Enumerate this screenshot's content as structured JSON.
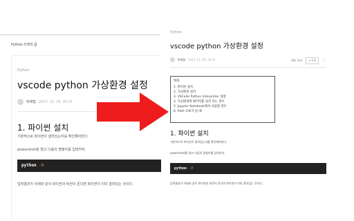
{
  "left": {
    "breadcrumb": "Python 5개의 글",
    "category": "Python",
    "title": "vscode python 가상환경 설정",
    "author": "박재형",
    "date": "2023. 11. 24. 20:31",
    "heading": "1. 파이썬 설치",
    "para1": "기본적으로 파이썬이 깔려있는지를 확인해야한다.",
    "para2": "powershell을 열고 다음의 명령어를 입력하자.",
    "code_cmd": "python",
    "code_flag": "-V",
    "para3": "입력결과가 아래와 같이 파이썬과 버전이 존다면 파이썬이 이미 깔려있는 것이다."
  },
  "right": {
    "category": "Python",
    "title": "vscode python 가상환경 설정",
    "author": "박재형",
    "date": "2023. 11. 24. 20:31",
    "url_copy": "URL 복사",
    "subscribe": "+구독",
    "more": "⋮",
    "toc_title": "목차",
    "toc_items": [
      "1. 파이썬 설치",
      "2. 가상환경 설치",
      "3. VSCode Python Interpreter 설정",
      "4. 가상환경에 패키지를 설치 하는 경우",
      "5. Jupyter Notebook에서 사용할 경우",
      "6. Path 오류가 날 때"
    ],
    "heading": "1. 파이썬 설치",
    "para1": "기본적으로 파이썬이 깔려있는지를 확인해야한다.",
    "para2": "powershell을 열고 다음의 명령어를 입력하자.",
    "code_cmd": "python",
    "code_flag": "-V",
    "para3": "입력결과가 아래와 같이 파이썬과 버전이 존다면 파이썬이 이미 깔려있는 것이다."
  },
  "arrow": {
    "color": "#ee1c1c",
    "icon": "arrow-right-icon"
  }
}
